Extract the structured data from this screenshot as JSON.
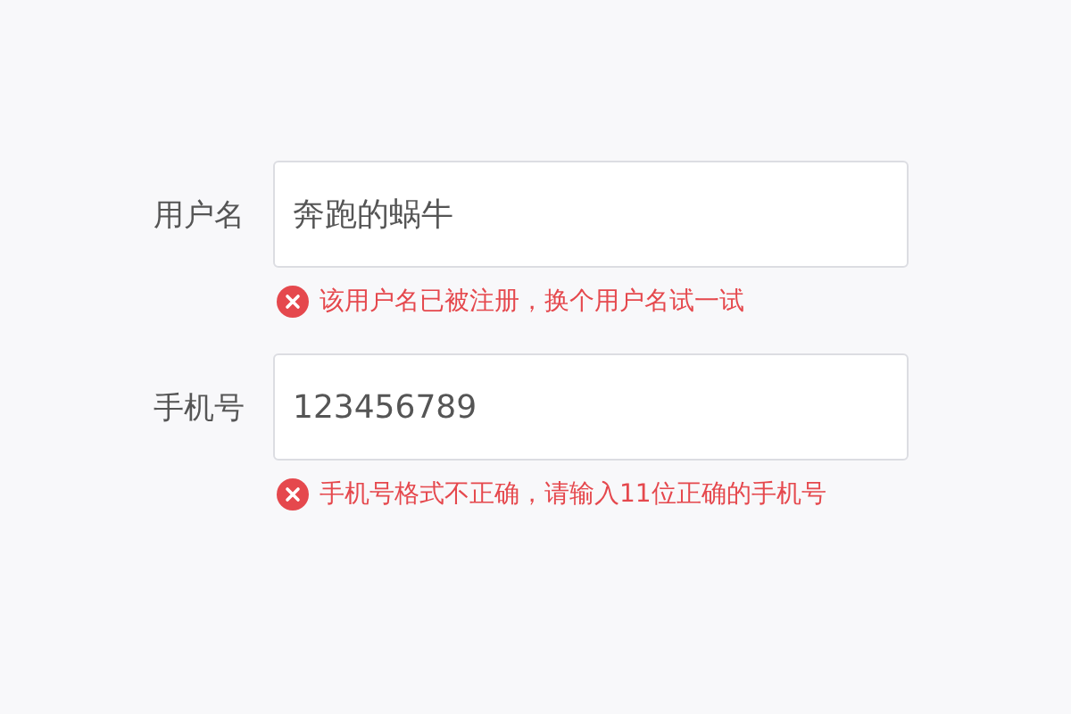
{
  "fields": [
    {
      "label": "用户名",
      "value": "奔跑的蜗牛",
      "error": "该用户名已被注册，换个用户名试一试"
    },
    {
      "label": "手机号",
      "value": "123456789",
      "error": "手机号格式不正确，请输入11位正确的手机号"
    }
  ]
}
